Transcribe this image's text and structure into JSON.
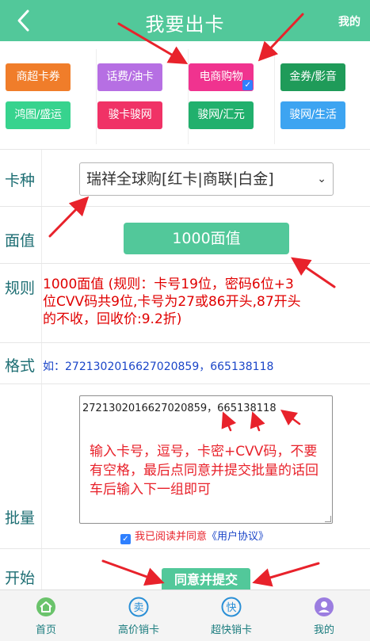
{
  "header": {
    "title": "我要出卡",
    "right_link": "我的"
  },
  "categories": [
    {
      "label": "商超卡券",
      "color": "#f07d2a"
    },
    {
      "label": "话费/油卡",
      "color": "#b66fe3"
    },
    {
      "label": "电商购物",
      "color": "#f0338f",
      "selected": true
    },
    {
      "label": "金券/影音",
      "color": "#1f9b59"
    },
    {
      "label": "鸿图/盛运",
      "color": "#37d38e"
    },
    {
      "label": "骏卡骏网",
      "color": "#f03266"
    },
    {
      "label": "骏网/汇元",
      "color": "#21b06d"
    },
    {
      "label": "骏网/生活",
      "color": "#3da4f1"
    }
  ],
  "form": {
    "card_type": {
      "label": "卡种",
      "value": "瑞祥全球购[红卡|商联|白金]"
    },
    "face_value": {
      "label": "面值",
      "button": "1000面值"
    },
    "rule": {
      "label": "规则",
      "text": "1000面值   (规则：卡号19位，密码6位+3位CVV码共9位,卡号为27或86开头,87开头的不收，回收价:9.2折)"
    },
    "format": {
      "label": "格式",
      "text": "如：2721302016627020859，665138118"
    },
    "batch": {
      "label": "批量",
      "value": "2721302016627020859，665138118",
      "hint": "输入卡号，逗号，卡密+CVV码，不要有空格，最后点同意并提交批量的话回车后输入下一组即可"
    },
    "agreement": {
      "checked": true,
      "prefix": "我已阅读并同意",
      "link": "《用户协议》"
    },
    "start": {
      "label": "开始",
      "button": "同意并提交"
    }
  },
  "tabbar": [
    {
      "label": "首页",
      "icon": "home-icon",
      "color": "#6ac36b"
    },
    {
      "label": "高价销卡",
      "icon": "sell-icon",
      "color": "#2a8fd6"
    },
    {
      "label": "超快销卡",
      "icon": "fast-icon",
      "color": "#2a8fd6"
    },
    {
      "label": "我的",
      "icon": "user-icon",
      "color": "#9b7de0"
    }
  ],
  "colors": {
    "brand": "#52c89a",
    "annotation_red": "#e8222b",
    "label_teal": "#1d6e73"
  }
}
